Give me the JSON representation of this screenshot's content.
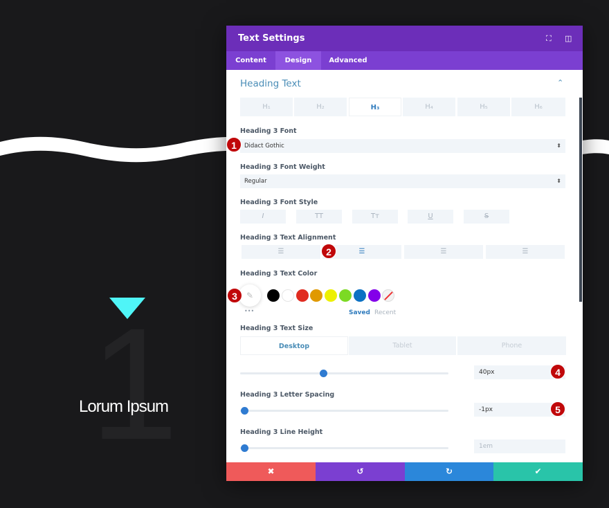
{
  "background": {
    "heading": "Lorum Ipsum",
    "big_number": "1",
    "accent": "#4ff5f7"
  },
  "modal": {
    "title": "Text Settings",
    "header_icons": [
      "expand-icon",
      "sidebar-toggle-icon"
    ],
    "tabs": [
      {
        "label": "Content"
      },
      {
        "label": "Design",
        "active": true
      },
      {
        "label": "Advanced"
      }
    ],
    "section_title": "Heading Text",
    "heading_tabs": [
      "H₁",
      "H₂",
      "H₃",
      "H₄",
      "H₅",
      "H₆"
    ],
    "heading_active": "H₃",
    "font": {
      "label": "Heading 3 Font",
      "value": "Didact Gothic"
    },
    "weight": {
      "label": "Heading 3 Font Weight",
      "value": "Regular"
    },
    "style": {
      "label": "Heading 3 Font Style",
      "buttons": [
        "I",
        "TT",
        "Tт",
        "U",
        "S"
      ]
    },
    "alignment": {
      "label": "Heading 3 Text Alignment",
      "selected": "center",
      "options": [
        "left",
        "center",
        "right",
        "justify"
      ]
    },
    "color": {
      "label": "Heading 3 Text Color",
      "swatches": [
        "#000000",
        "#ffffff",
        "#e02b20",
        "#e09900",
        "#edf000",
        "#7cda24",
        "#0c71c3",
        "#8300e9"
      ],
      "saved": "Saved",
      "recent": "Recent",
      "more": "•••"
    },
    "size": {
      "label": "Heading 3 Text Size",
      "devices": [
        "Desktop",
        "Tablet",
        "Phone"
      ],
      "active_device": "Desktop",
      "value": "40px",
      "slider_percent": 40
    },
    "letter_spacing": {
      "label": "Heading 3 Letter Spacing",
      "value": "-1px",
      "slider_percent": 0
    },
    "line_height": {
      "label": "Heading 3 Line Height",
      "value": "1em",
      "slider_percent": 0
    },
    "footer": {
      "cancel": "✖",
      "undo": "↺",
      "redo": "↻",
      "save": "✔",
      "colors": [
        "#ef5a5a",
        "#7b3fd1",
        "#2b87da",
        "#29c4a9"
      ]
    },
    "badges": [
      "1",
      "2",
      "3",
      "4",
      "5"
    ]
  }
}
